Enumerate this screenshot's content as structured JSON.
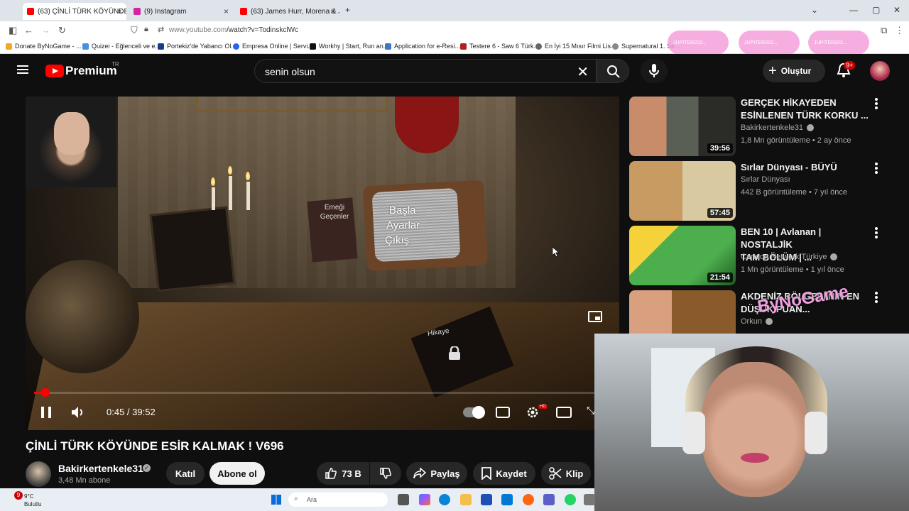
{
  "browser": {
    "tabs": [
      {
        "label": "(63) ÇİNLİ TÜRK KÖYÜNDE",
        "active": true
      },
      {
        "label": "(9) Instagram",
        "active": false
      },
      {
        "label": "(63) James Hurr, Morena & Jay",
        "active": false
      }
    ],
    "url_host": "www.youtube.com",
    "url_path": "/watch?v=TodinskclWc",
    "bookmarks": [
      "Donate ByNoGame - ...",
      "Quizei - Eğlenceli ve e...",
      "Portekiz'de Yabancı Ol...",
      "Empresa Online | Servi...",
      "Workhy | Start, Run an...",
      "Application for e-Resi...",
      "Testere 6 - Saw 6 Türk...",
      "En İyi 15 Mısır Filmi Lis...",
      "Supernatural 1. Se..."
    ],
    "overlay_pills": [
      "JUPITER202...",
      "JUPITER202...",
      "JUPITER202..."
    ]
  },
  "header": {
    "brand": "Premium",
    "region": "TR",
    "search_value": "senin olsun",
    "create_label": "Oluştur",
    "notif_count": "9+"
  },
  "player": {
    "tv_menu": [
      "Başla",
      "Ayarlar",
      "Çıkış"
    ],
    "card_label": "Emeği Geçenler",
    "book_label": "Hikaye",
    "time": "0:45 / 39:52",
    "progress": 0.019,
    "hd_badge": "HD"
  },
  "video": {
    "title": "ÇİNLİ TÜRK KÖYÜNDE ESİR KALMAK ! V696",
    "channel": "Bakirkertenkele31",
    "subscribers": "3,48 Mn abone",
    "join_label": "Katıl",
    "subscribe_label": "Abone ol",
    "like_count": "73 B",
    "share_label": "Paylaş",
    "save_label": "Kaydet",
    "clip_label": "Klip"
  },
  "recommendations": [
    {
      "title": "GERÇEK HİKAYEDEN\nESİNLENEN TÜRK KORKU ...",
      "channel": "Bakirkertenkele31",
      "verified": true,
      "meta": "1,8 Mn görüntüleme • 2 ay önce",
      "duration": "39:56",
      "thumb_color": "#6a6a64"
    },
    {
      "title": "Sırlar Dünyası - BÜYÜ",
      "channel": "Sırlar Dünyası",
      "verified": false,
      "meta": "442 B görüntüleme • 7 yıl önce",
      "duration": "57:45",
      "thumb_color": "#8a6a40"
    },
    {
      "title": "BEN 10 | Avlanan | NOSTALJİK\nTAM BÖLÜM | ...",
      "channel": "Cartoon Network Türkiye",
      "verified": true,
      "meta": "1 Mn görüntüleme • 1 yıl önce",
      "duration": "21:54",
      "thumb_color": "#3d8a3a"
    },
    {
      "title": "AKDENİZ BÖLGESİ'NİN EN\nDÜŞÜK PUAN...",
      "channel": "Orkun",
      "verified": true,
      "meta": "",
      "duration": "",
      "thumb_color": "#a0503a"
    }
  ],
  "overlay": {
    "stream_tag": "ByNoGame"
  },
  "taskbar": {
    "temperature": "9°C",
    "weather": "Bulutlu",
    "weather_badge": "9",
    "search_placeholder": "Ara"
  },
  "colors": {
    "yt_red": "#ff0000",
    "bg": "#0f0f0f",
    "chip": "#272727"
  }
}
